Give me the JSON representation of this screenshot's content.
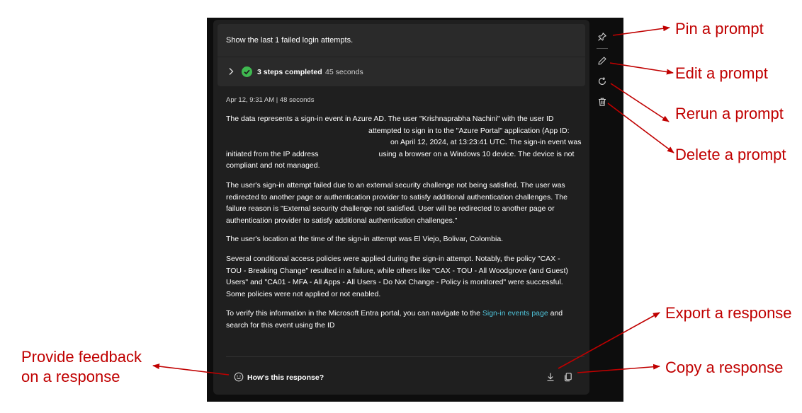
{
  "prompt": {
    "text": "Show the last 1 failed login attempts.",
    "steps_label": "3 steps completed",
    "steps_time": "45 seconds"
  },
  "response": {
    "meta": "Apr 12, 9:31 AM  |  48 seconds",
    "p1": [
      "The data represents a sign-in event in Azure AD. The user \"Krishnaprabha Nachini\" with the user ID",
      "attempted to sign in to the \"Azure Portal\" application (App ID:",
      "on April 12, 2024, at 13:23:41 UTC. The sign-in event was",
      "initiated from the IP address",
      "using a browser on a Windows 10 device. The device is not",
      "compliant and not managed."
    ],
    "p2": [
      "The user's sign-in attempt failed due to an external security challenge not being satisfied. The user was",
      "redirected to another page or authentication provider to satisfy additional authentication challenges. The",
      "failure reason is \"External security challenge not satisfied. User will be redirected to another page or",
      "authentication provider to satisfy additional authentication challenges.\""
    ],
    "p3": [
      "The user's location at the time of the sign-in attempt was El Viejo, Bolivar, Colombia."
    ],
    "p4": [
      "Several conditional access policies were applied during the sign-in attempt. Notably, the policy \"CAX -",
      "TOU - Breaking Change\" resulted in a failure, while others like \"CAX - TOU - All Woodgrove (and Guest)",
      "Users\" and \"CA01 - MFA - All Apps - All Users - Do Not Change - Policy is monitored\" were successful.",
      "Some policies were not applied or not enabled."
    ],
    "p5": {
      "before_link": "To verify this information in the Microsoft Entra portal, you can navigate to the ",
      "link": "Sign-in events page",
      "after_link": " and",
      "line2": "search for this event using the ID"
    },
    "feedback_label": "How's this response?"
  },
  "annotations": {
    "pin": "Pin a prompt",
    "edit": "Edit a prompt",
    "rerun": "Rerun a prompt",
    "delete": "Delete a prompt",
    "export": "Export a response",
    "copy": "Copy a response",
    "feedback_line1": "Provide feedback",
    "feedback_line2": "on a response"
  },
  "icons": [
    "pin-icon",
    "edit-icon",
    "rerun-icon",
    "delete-icon",
    "export-icon",
    "copy-icon",
    "smile-icon",
    "chevron-right-icon",
    "check-circle-icon"
  ],
  "colors": {
    "background": "#0d0d0d",
    "card": "#1f1f1f",
    "prompt": "#2a2a2a",
    "success": "#3fb950",
    "link": "#4fc3d9",
    "annotation": "#c00000"
  }
}
